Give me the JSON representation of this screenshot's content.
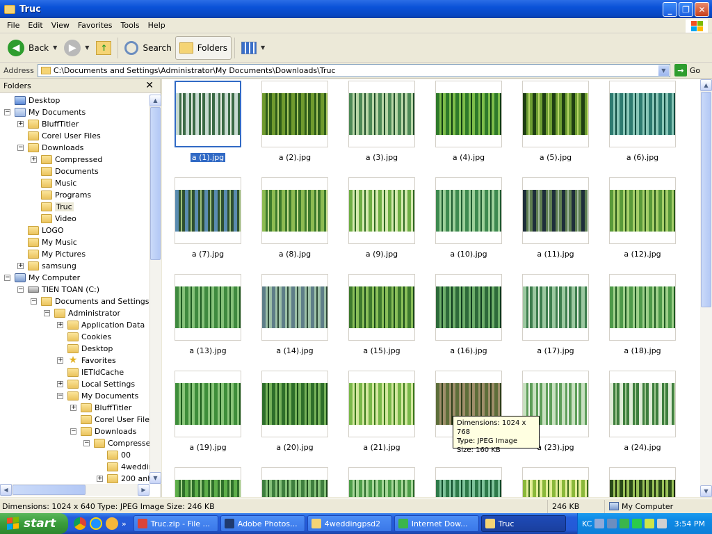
{
  "window": {
    "title": "Truc"
  },
  "menu": [
    "File",
    "Edit",
    "View",
    "Favorites",
    "Tools",
    "Help"
  ],
  "toolbar": {
    "back": "Back",
    "search": "Search",
    "folders": "Folders"
  },
  "address": {
    "label": "Address",
    "path": "C:\\Documents and Settings\\Administrator\\My Documents\\Downloads\\Truc",
    "go": "Go"
  },
  "folder_pane": {
    "title": "Folders",
    "tree": [
      {
        "label": "Desktop",
        "level": 0,
        "exp": "",
        "icon": "desk"
      },
      {
        "label": "My Documents",
        "level": 0,
        "exp": "-",
        "icon": "doc"
      },
      {
        "label": "BluffTitler",
        "level": 1,
        "exp": "+",
        "icon": "folder"
      },
      {
        "label": "Corel User Files",
        "level": 1,
        "exp": "",
        "icon": "folder"
      },
      {
        "label": "Downloads",
        "level": 1,
        "exp": "-",
        "icon": "folder"
      },
      {
        "label": "Compressed",
        "level": 2,
        "exp": "+",
        "icon": "folder"
      },
      {
        "label": "Documents",
        "level": 2,
        "exp": "",
        "icon": "folder"
      },
      {
        "label": "Music",
        "level": 2,
        "exp": "",
        "icon": "folder"
      },
      {
        "label": "Programs",
        "level": 2,
        "exp": "",
        "icon": "folder"
      },
      {
        "label": "Truc",
        "level": 2,
        "exp": "",
        "icon": "folder",
        "selected": true
      },
      {
        "label": "Video",
        "level": 2,
        "exp": "",
        "icon": "folder"
      },
      {
        "label": "LOGO",
        "level": 1,
        "exp": "",
        "icon": "folder"
      },
      {
        "label": "My Music",
        "level": 1,
        "exp": "",
        "icon": "folder"
      },
      {
        "label": "My Pictures",
        "level": 1,
        "exp": "",
        "icon": "folder"
      },
      {
        "label": "samsung",
        "level": 1,
        "exp": "+",
        "icon": "folder"
      },
      {
        "label": "My Computer",
        "level": 0,
        "exp": "-",
        "icon": "comp"
      },
      {
        "label": "TIEN TOAN (C:)",
        "level": 1,
        "exp": "-",
        "icon": "drive"
      },
      {
        "label": "Documents and Settings",
        "level": 2,
        "exp": "-",
        "icon": "folder"
      },
      {
        "label": "Administrator",
        "level": 3,
        "exp": "-",
        "icon": "folder"
      },
      {
        "label": "Application Data",
        "level": 4,
        "exp": "+",
        "icon": "folder"
      },
      {
        "label": "Cookies",
        "level": 4,
        "exp": "",
        "icon": "folder"
      },
      {
        "label": "Desktop",
        "level": 4,
        "exp": "",
        "icon": "folder"
      },
      {
        "label": "Favorites",
        "level": 4,
        "exp": "+",
        "icon": "star"
      },
      {
        "label": "IETldCache",
        "level": 4,
        "exp": "",
        "icon": "folder"
      },
      {
        "label": "Local Settings",
        "level": 4,
        "exp": "+",
        "icon": "folder"
      },
      {
        "label": "My Documents",
        "level": 4,
        "exp": "-",
        "icon": "folder"
      },
      {
        "label": "BluffTitler",
        "level": 5,
        "exp": "+",
        "icon": "folder"
      },
      {
        "label": "Corel User Files",
        "level": 5,
        "exp": "",
        "icon": "folder"
      },
      {
        "label": "Downloads",
        "level": 5,
        "exp": "-",
        "icon": "folder"
      },
      {
        "label": "Compressed",
        "level": 6,
        "exp": "-",
        "icon": "folder"
      },
      {
        "label": "00",
        "level": 7,
        "exp": "",
        "icon": "folder"
      },
      {
        "label": "4weddin",
        "level": 7,
        "exp": "",
        "icon": "folder"
      },
      {
        "label": "200 anh",
        "level": 7,
        "exp": "+",
        "icon": "folder"
      }
    ]
  },
  "files": [
    "a (1).jpg",
    "a (2).jpg",
    "a (3).jpg",
    "a (4).jpg",
    "a (5).jpg",
    "a (6).jpg",
    "a (7).jpg",
    "a (8).jpg",
    "a (9).jpg",
    "a (10).jpg",
    "a (11).jpg",
    "a (12).jpg",
    "a (13).jpg",
    "a (14).jpg",
    "a (15).jpg",
    "a (16).jpg",
    "a (17).jpg",
    "a (18).jpg",
    "a (19).jpg",
    "a (20).jpg",
    "a (21).jpg",
    "",
    "a (23).jpg",
    "a (24).jpg",
    "",
    "",
    "",
    "",
    "",
    ""
  ],
  "selected_file": "a (1).jpg",
  "tooltip": {
    "line1": "Dimensions: 1024 x 768",
    "line2": "Type: JPEG Image",
    "line3": "Size: 160 KB"
  },
  "statusbar": {
    "info": "Dimensions: 1024 x 640 Type: JPEG Image Size: 246 KB",
    "size": "246 KB",
    "zone": "My Computer"
  },
  "taskbar": {
    "start": "start",
    "tasks": [
      "Truc.zip - File ...",
      "Adobe Photos...",
      "4weddingpsd2",
      "Internet Dow...",
      "Truc"
    ],
    "tray_label": "KC",
    "clock": "3:54 PM"
  },
  "colors": {
    "selection": "#316AC5",
    "titlebar": "#0A52D8",
    "taskbar": "#245DDB",
    "start": "#3A9C3A"
  }
}
